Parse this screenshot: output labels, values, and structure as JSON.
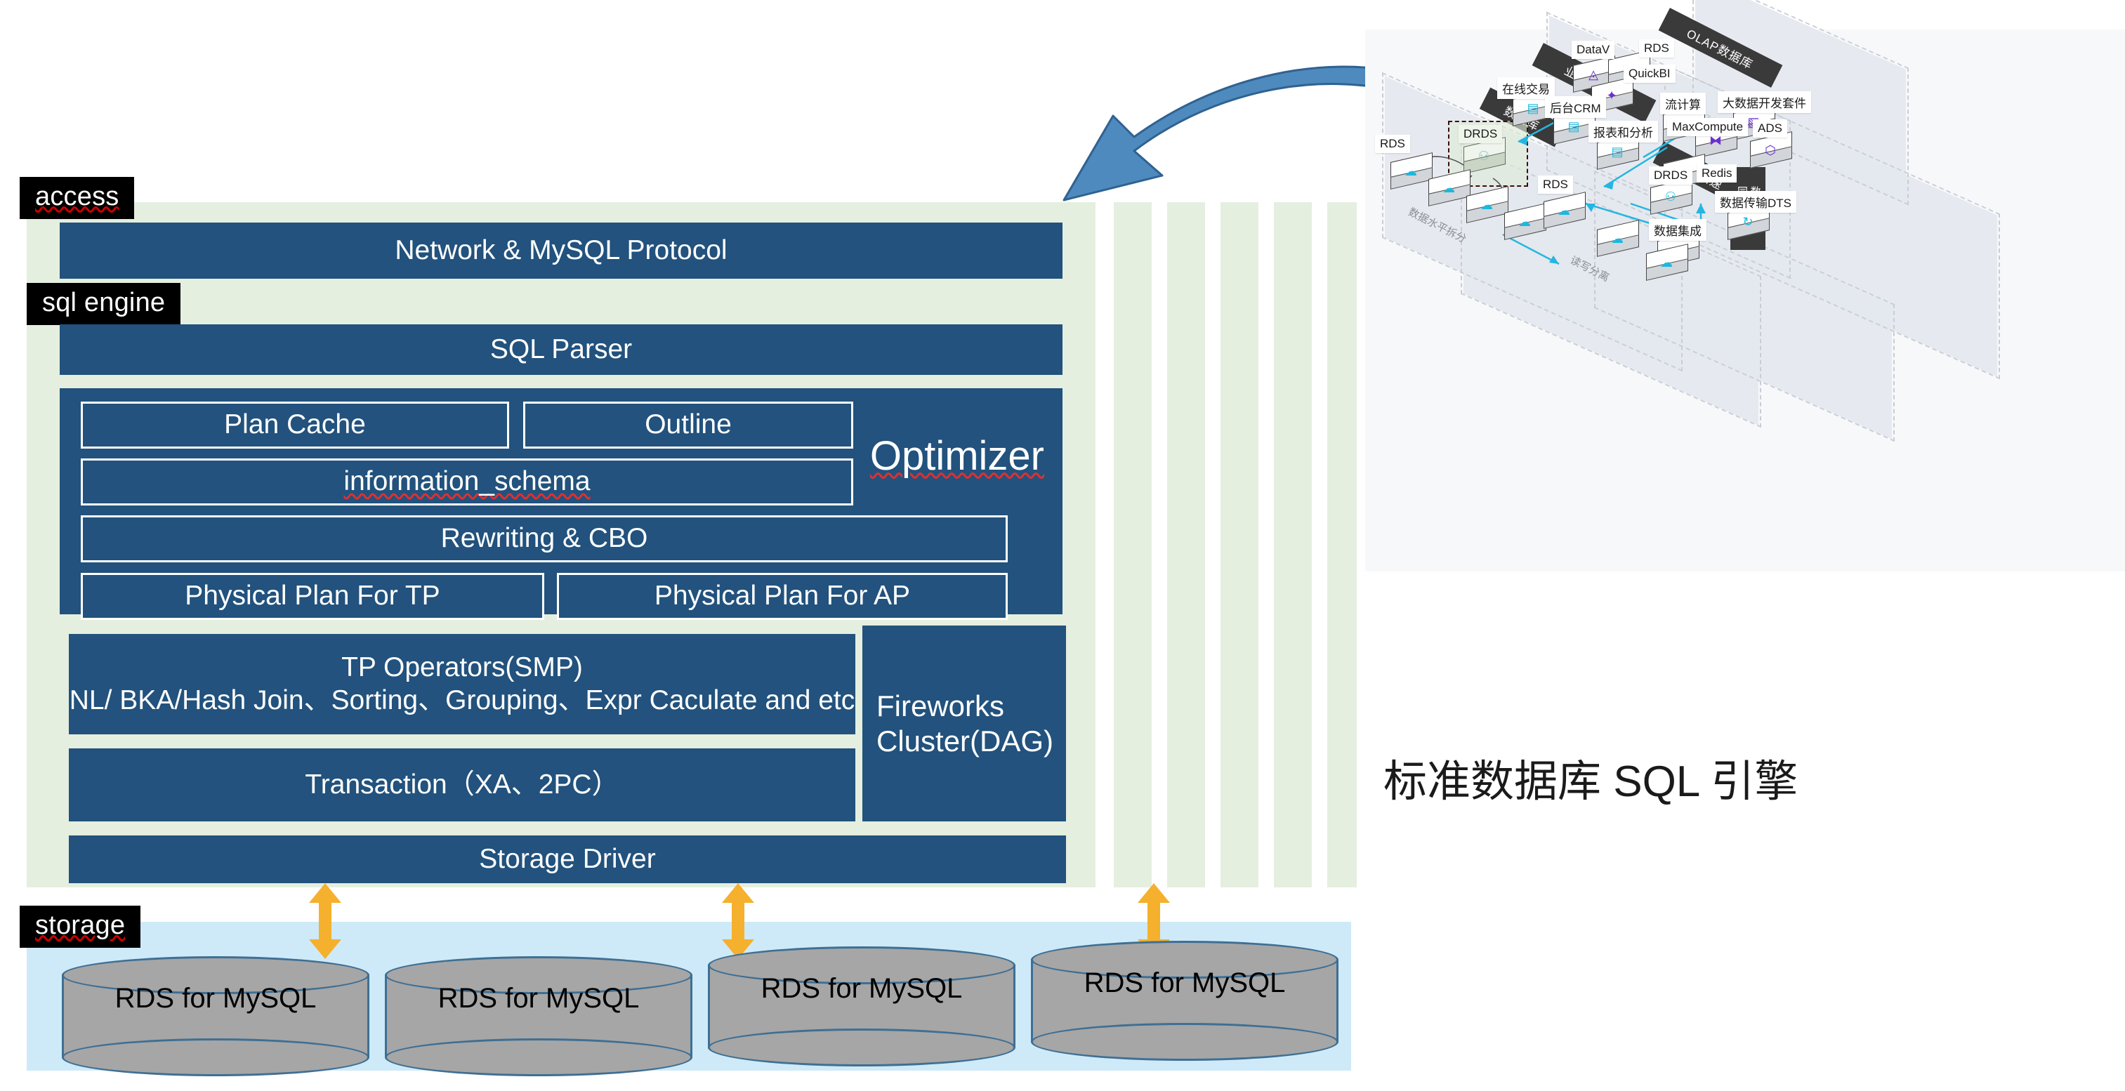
{
  "layers": {
    "access_tag": "access",
    "sql_engine_tag": "sql engine",
    "storage_tag": "storage"
  },
  "blocks": {
    "network": "Network & MySQL Protocol",
    "sql_parser": "SQL Parser",
    "plan_cache": "Plan Cache",
    "outline": "Outline",
    "information_schema": "information_schema",
    "optimizer": "Optimizer",
    "rewriting_cbo": "Rewriting & CBO",
    "physical_plan_tp": "Physical Plan For TP",
    "physical_plan_ap": "Physical Plan For AP",
    "tp_operators_line1": "TP Operators(SMP)",
    "tp_operators_line2": "NL/ BKA/Hash Join、Sorting、Grouping、Expr Caculate and etc",
    "transaction": "Transaction（XA、2PC）",
    "storage_driver": "Storage Driver",
    "fireworks_line1": "Fireworks",
    "fireworks_line2": "Cluster(DAG)"
  },
  "storage_nodes": [
    {
      "label": "RDS for MySQL"
    },
    {
      "label": "RDS for MySQL"
    },
    {
      "label": "RDS for MySQL"
    },
    {
      "label": "RDS for MySQL"
    }
  ],
  "illustration": {
    "band_labels": [
      {
        "text": "业务逻辑层"
      },
      {
        "text": "OLAP数据库"
      },
      {
        "text": "数据库"
      },
      {
        "text": "缓存加速"
      },
      {
        "text": "数据迁移\n同步工具"
      }
    ],
    "nodes": [
      {
        "label": "DataV",
        "glyph": "◬"
      },
      {
        "label": "RDS",
        "glyph": "☁"
      },
      {
        "label": "QuickBI",
        "glyph": "✦"
      },
      {
        "label": "在线交易",
        "glyph": "▤"
      },
      {
        "label": "后台CRM",
        "glyph": "▤"
      },
      {
        "label": "报表和分析",
        "glyph": "▤"
      },
      {
        "label": "流计算",
        "glyph": "⌁"
      },
      {
        "label": "大数据开发套件",
        "glyph": "▧"
      },
      {
        "label": "MaxCompute",
        "glyph": "⧓"
      },
      {
        "label": "ADS",
        "glyph": "⬡"
      },
      {
        "label": "Redis",
        "glyph": "☰"
      },
      {
        "label": "数据传输DTS",
        "glyph": "↻"
      },
      {
        "label": "数据集成",
        "glyph": "∞"
      },
      {
        "label": "DRDS",
        "glyph": "⚇"
      },
      {
        "label": "RDS",
        "glyph": "☁"
      },
      {
        "label": "DRDS",
        "glyph": "⚇"
      },
      {
        "label": "RDS",
        "glyph": "☁"
      }
    ],
    "rotated_labels": [
      {
        "text": "数据水平拆分"
      },
      {
        "text": "读写分离"
      }
    ]
  },
  "caption": {
    "text": "标准数据库 SQL 引擎"
  },
  "colors": {
    "block_blue": "#22527D",
    "panel_green": "#E5EFDF",
    "panel_blue": "#CEEAF8",
    "arrow_orange": "#F5B02E",
    "curve_arrow_blue": "#4E8ABE",
    "cylinder_gray": "#A6A6A6",
    "tag_black": "#000000"
  }
}
